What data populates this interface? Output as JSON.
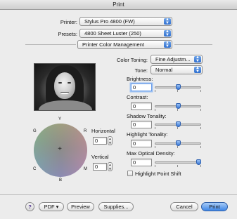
{
  "window": {
    "title": "Print"
  },
  "printer": {
    "label": "Printer:",
    "value": "Stylus Pro 4800 (FW)"
  },
  "presets": {
    "label": "Presets:",
    "value": "4800 Sheet Luster (250)"
  },
  "panel": {
    "value": "Printer Color Management"
  },
  "color_toning": {
    "label": "Color Toning:",
    "value": "Fine Adjustm..."
  },
  "tone": {
    "label": "Tone:",
    "value": "Normal"
  },
  "brightness": {
    "label": "Brightness:",
    "value": "0",
    "level": 0.5
  },
  "contrast": {
    "label": "Contrast:",
    "value": "0",
    "level": 0.5
  },
  "shadow_tonality": {
    "label": "Shadow Tonality:",
    "value": "0",
    "level": 0.5
  },
  "highlight_tonality": {
    "label": "Highlight Tonality:",
    "value": "0",
    "level": 0.5
  },
  "max_optical_density": {
    "label": "Max Optical Density:",
    "value": "0",
    "level": 1.0
  },
  "highlight_point_shift": {
    "label": "Highlight Point Shift",
    "checked": false
  },
  "color_wheel": {
    "labels": {
      "y": "Y",
      "r": "R",
      "m": "M",
      "b": "B",
      "c": "C",
      "g": "G"
    }
  },
  "horizontal": {
    "label": "Horizontal",
    "value": "0"
  },
  "vertical": {
    "label": "Vertical",
    "value": "0"
  },
  "buttons": {
    "help": "?",
    "pdf": "PDF ▾",
    "preview": "Preview",
    "supplies": "Supplies...",
    "cancel": "Cancel",
    "print": "Print"
  },
  "colors": {
    "accent": "#3f86e6",
    "window_bg": "#ececec"
  }
}
